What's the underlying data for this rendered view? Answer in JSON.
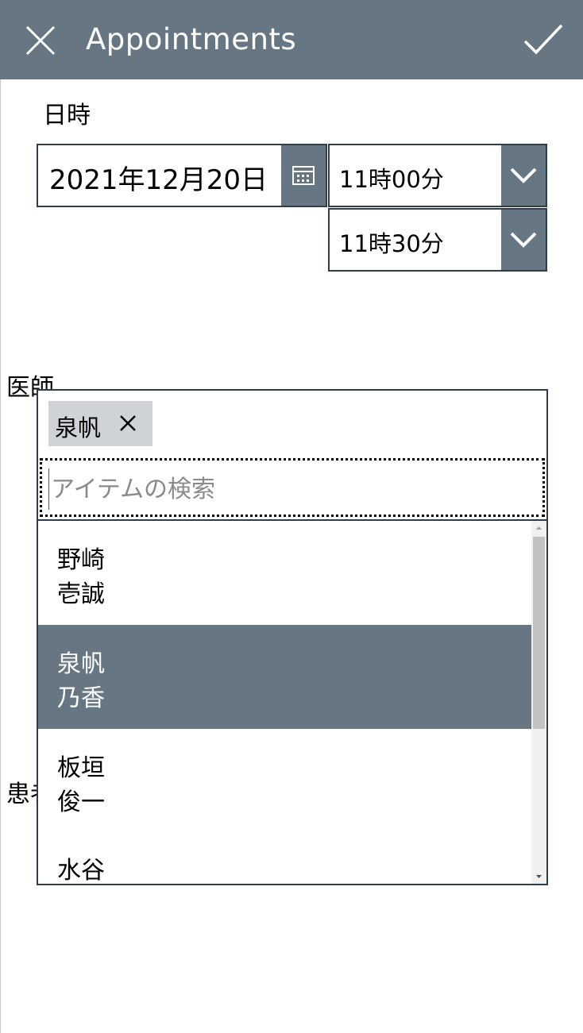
{
  "header": {
    "title": "Appointments",
    "close_icon": "close-icon",
    "confirm_icon": "checkmark-icon",
    "background": "#667683"
  },
  "datetime": {
    "label": "日時",
    "date_value": "2021年12月20日",
    "start_time": "11時00分",
    "end_time": "11時30分"
  },
  "doctor": {
    "label": "医師",
    "selected_chip": "泉帆",
    "search_placeholder": "アイテムの検索",
    "items": [
      {
        "line1": "野崎",
        "line2": "壱誠",
        "selected": false
      },
      {
        "line1": "泉帆",
        "line2": "乃香",
        "selected": true
      },
      {
        "line1": "板垣",
        "line2": "俊一",
        "selected": false
      },
      {
        "line1": "水谷",
        "line2": "",
        "selected": false
      }
    ]
  },
  "patient": {
    "label": "患者"
  },
  "colors": {
    "accent": "#667683",
    "border": "#2f3e4a",
    "chip": "#cfd3d7"
  }
}
